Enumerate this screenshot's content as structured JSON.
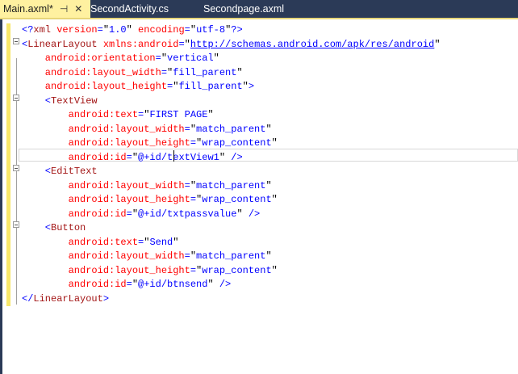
{
  "tabs": [
    {
      "label": "Main.axml*",
      "active": true
    },
    {
      "label": "SecondActivity.cs"
    },
    {
      "label": "Secondpage.axml"
    }
  ],
  "code": [
    [
      [
        "p",
        "<?"
      ],
      [
        "e",
        "xml"
      ],
      [
        "a",
        " version"
      ],
      [
        "p",
        "="
      ],
      [
        "q",
        "\""
      ],
      [
        "v",
        "1.0"
      ],
      [
        "q",
        "\""
      ],
      [
        "a",
        " encoding"
      ],
      [
        "p",
        "="
      ],
      [
        "q",
        "\""
      ],
      [
        "v",
        "utf-8"
      ],
      [
        "q",
        "\""
      ],
      [
        "p",
        "?>"
      ]
    ],
    [
      [
        "p",
        "<"
      ],
      [
        "e",
        "LinearLayout"
      ],
      [
        "a",
        " xmlns:android"
      ],
      [
        "p",
        "="
      ],
      [
        "q",
        "\""
      ],
      [
        "l",
        "http://schemas.android.com/apk/res/android"
      ],
      [
        "q",
        "\""
      ]
    ],
    [
      [
        "a",
        "    android:orientation"
      ],
      [
        "p",
        "="
      ],
      [
        "q",
        "\""
      ],
      [
        "v",
        "vertical"
      ],
      [
        "q",
        "\""
      ]
    ],
    [
      [
        "a",
        "    android:layout_width"
      ],
      [
        "p",
        "="
      ],
      [
        "q",
        "\""
      ],
      [
        "v",
        "fill_parent"
      ],
      [
        "q",
        "\""
      ]
    ],
    [
      [
        "a",
        "    android:layout_height"
      ],
      [
        "p",
        "="
      ],
      [
        "q",
        "\""
      ],
      [
        "v",
        "fill_parent"
      ],
      [
        "q",
        "\""
      ],
      [
        "p",
        ">"
      ]
    ],
    [
      [
        "p",
        "    <"
      ],
      [
        "e",
        "TextView"
      ]
    ],
    [
      [
        "a",
        "        android:text"
      ],
      [
        "p",
        "="
      ],
      [
        "q",
        "\""
      ],
      [
        "v",
        "FIRST PAGE"
      ],
      [
        "q",
        "\""
      ]
    ],
    [
      [
        "a",
        "        android:layout_width"
      ],
      [
        "p",
        "="
      ],
      [
        "q",
        "\""
      ],
      [
        "v",
        "match_parent"
      ],
      [
        "q",
        "\""
      ]
    ],
    [
      [
        "a",
        "        android:layout_height"
      ],
      [
        "p",
        "="
      ],
      [
        "q",
        "\""
      ],
      [
        "v",
        "wrap_content"
      ],
      [
        "q",
        "\""
      ]
    ],
    [
      [
        "a",
        "        android:id"
      ],
      [
        "p",
        "="
      ],
      [
        "q",
        "\""
      ],
      [
        "v",
        "@+id/textView1"
      ],
      [
        "q",
        "\""
      ],
      [
        "p",
        " />"
      ]
    ],
    [
      [
        "p",
        "    <"
      ],
      [
        "e",
        "EditText"
      ]
    ],
    [
      [
        "a",
        "        android:layout_width"
      ],
      [
        "p",
        "="
      ],
      [
        "q",
        "\""
      ],
      [
        "v",
        "match_parent"
      ],
      [
        "q",
        "\""
      ]
    ],
    [
      [
        "a",
        "        android:layout_height"
      ],
      [
        "p",
        "="
      ],
      [
        "q",
        "\""
      ],
      [
        "v",
        "wrap_content"
      ],
      [
        "q",
        "\""
      ]
    ],
    [
      [
        "a",
        "        android:id"
      ],
      [
        "p",
        "="
      ],
      [
        "q",
        "\""
      ],
      [
        "v",
        "@+id/txtpassvalue"
      ],
      [
        "q",
        "\""
      ],
      [
        "p",
        " />"
      ]
    ],
    [
      [
        "p",
        "    <"
      ],
      [
        "e",
        "Button"
      ]
    ],
    [
      [
        "a",
        "        android:text"
      ],
      [
        "p",
        "="
      ],
      [
        "q",
        "\""
      ],
      [
        "v",
        "Send"
      ],
      [
        "q",
        "\""
      ]
    ],
    [
      [
        "a",
        "        android:layout_width"
      ],
      [
        "p",
        "="
      ],
      [
        "q",
        "\""
      ],
      [
        "v",
        "match_parent"
      ],
      [
        "q",
        "\""
      ]
    ],
    [
      [
        "a",
        "        android:layout_height"
      ],
      [
        "p",
        "="
      ],
      [
        "q",
        "\""
      ],
      [
        "v",
        "wrap_content"
      ],
      [
        "q",
        "\""
      ]
    ],
    [
      [
        "a",
        "        android:id"
      ],
      [
        "p",
        "="
      ],
      [
        "q",
        "\""
      ],
      [
        "v",
        "@+id/btnsend"
      ],
      [
        "q",
        "\""
      ],
      [
        "p",
        " />"
      ]
    ],
    [
      [
        "p",
        "</"
      ],
      [
        "e",
        "LinearLayout"
      ],
      [
        "p",
        ">"
      ]
    ]
  ]
}
